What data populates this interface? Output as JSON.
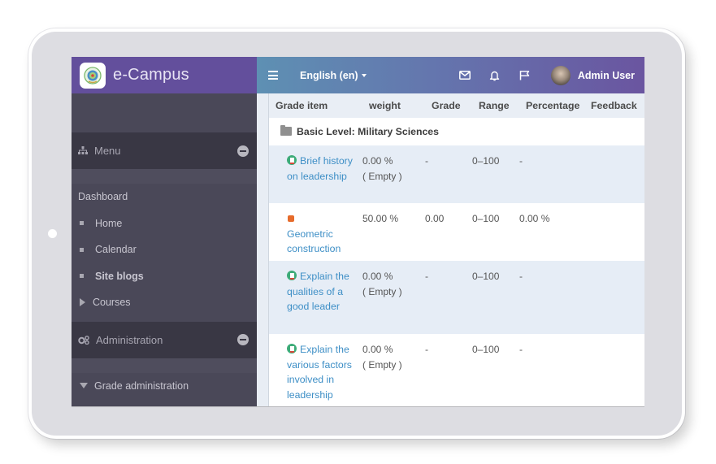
{
  "brand": {
    "name": "e-Campus"
  },
  "navbar": {
    "language": "English (en)",
    "icons": [
      "menu-icon",
      "envelope-icon",
      "bell-icon",
      "flag-icon"
    ],
    "user_name": "Admin User"
  },
  "sidebar": {
    "menu_block": {
      "title": "Menu",
      "icon": "sitemap-icon"
    },
    "section_label": "Dashboard",
    "items": [
      {
        "label": "Home",
        "bullet": "square"
      },
      {
        "label": "Calendar",
        "bullet": "square"
      },
      {
        "label": "Site blogs",
        "bullet": "square",
        "bold": true
      },
      {
        "label": "Courses",
        "bullet": "triangle-right"
      }
    ],
    "admin_block": {
      "title": "Administration",
      "icon": "cogs-icon"
    },
    "admin_items": [
      {
        "label": "Grade administration",
        "bullet": "triangle-down"
      }
    ]
  },
  "grades": {
    "columns": [
      "Grade item",
      "weight",
      "Grade",
      "Range",
      "Percentage",
      "Feedback"
    ],
    "category": "Basic Level: Military Sciences",
    "rows": [
      {
        "icon": "assignment-icon",
        "item": "Brief history on leadership",
        "weight": "0.00 %",
        "weight_note": "( Empty )",
        "grade": "-",
        "range": "0–100",
        "percentage": "-",
        "feedback": ""
      },
      {
        "icon": "quiz-icon",
        "item": "Geometric construction",
        "weight": "50.00 %",
        "weight_note": "",
        "grade": "0.00",
        "range": "0–100",
        "percentage": "0.00 %",
        "feedback": ""
      },
      {
        "icon": "assignment-icon",
        "item": "Explain the qualities of a good leader",
        "weight": "0.00 %",
        "weight_note": "( Empty )",
        "grade": "-",
        "range": "0–100",
        "percentage": "-",
        "feedback": ""
      },
      {
        "icon": "assignment-icon",
        "item": "Explain the various factors involved in leadership",
        "weight": "0.00 %",
        "weight_note": "( Empty )",
        "grade": "-",
        "range": "0–100",
        "percentage": "-",
        "feedback": ""
      }
    ]
  },
  "colors": {
    "brand_purple": "#634f9c",
    "sidebar_bg": "#4a4858",
    "link_blue": "#3e8fc6",
    "row_shade": "#e6edf6"
  }
}
